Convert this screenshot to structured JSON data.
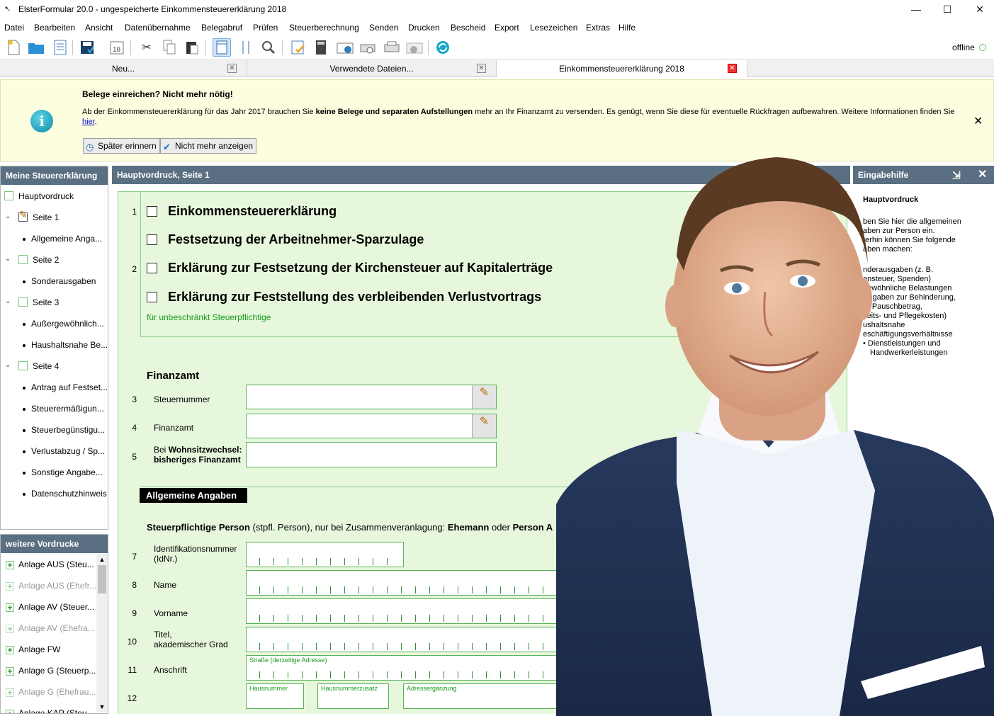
{
  "window": {
    "title": "ElsterFormular 20.0 - ungespeicherte Einkommensteuererklärung 2018",
    "minimize": "—",
    "maximize": "☐",
    "close": "✕"
  },
  "menu": [
    "Datei",
    "Bearbeiten",
    "Ansicht",
    "Datenübernahme",
    "Belegabruf",
    "Prüfen",
    "Steuerberechnung",
    "Senden",
    "Drucken",
    "Bescheid",
    "Export",
    "Lesezeichen",
    "Extras",
    "Hilfe"
  ],
  "toolbar": {
    "status": "offline",
    "calendar_day": "18",
    "icons": [
      "new-file-icon",
      "open-folder-icon",
      "list-icon",
      "save-icon",
      "calendar-icon",
      "cut-icon",
      "copy-icon",
      "paste-icon",
      "page-view-icon",
      "page-width-icon",
      "search-icon",
      "check-form-icon",
      "calculator-icon",
      "send-icon",
      "print-preview-icon",
      "print-icon",
      "download-icon",
      "refresh-icon"
    ]
  },
  "tabs": [
    {
      "label": "Neu..."
    },
    {
      "label": "Verwendete Dateien..."
    },
    {
      "label": "Einkommensteuererklärung 2018"
    }
  ],
  "banner": {
    "heading": "Belege einreichen? Nicht mehr nötig!",
    "text_1": "Ab der Einkommensteuererklärung für das Jahr 2017 brauchen Sie ",
    "text_bold": "keine Belege und separaten Aufstellungen",
    "text_2": " mehr an Ihr Finanzamt zu versenden. Es genügt, wenn Sie diese für eventuelle Rückfragen aufbewahren. Weitere Informationen finden Sie ",
    "link": "hier",
    "text_3": ".",
    "remind_later": "Später erinnern",
    "dont_show": "Nicht mehr anzeigen"
  },
  "left_panel": {
    "title": "Meine Steuererklärung",
    "items": [
      "Hauptvordruck",
      "Seite 1",
      "Allgemeine Anga...",
      "Seite 2",
      "Sonderausgaben",
      "Seite 3",
      "Außergewöhnlich...",
      "Haushaltsnahe Be...",
      "Seite 4",
      "Antrag auf Festset...",
      "Steuerermäßigun...",
      "Steuerbegünstigu...",
      "Verlustabzug / Sp...",
      "Sonstige Angabe...",
      "Datenschutzhinweis"
    ]
  },
  "more_panel": {
    "title": "weitere Vordrucke",
    "items": [
      "Anlage AUS (Steu...",
      "Anlage AUS (Ehefr...",
      "Anlage AV (Steuer...",
      "Anlage AV (Ehefra...",
      "Anlage FW",
      "Anlage G (Steuerp...",
      "Anlage G (Ehefrau...",
      "Anlage KAP (Steu..."
    ]
  },
  "main": {
    "title": "Hauptvordruck, Seite 1",
    "options": [
      "Einkommensteuererklärung",
      "Festsetzung der Arbeitnehmer-Sparzulage",
      "Erklärung zur Festsetzung der Kirchensteuer auf Kapitalerträge",
      "Erklärung zur Feststellung des verbleibenden Verlustvortrags"
    ],
    "unlimited_note": "für unbeschränkt Steuerpflichtige",
    "rows": {
      "r1": "1",
      "r2": "2",
      "r3": "3",
      "r4": "4",
      "r5": "5",
      "r7": "7",
      "r8": "8",
      "r9": "9",
      "r10": "10",
      "r11": "11",
      "r12": "12"
    },
    "finanzamt_heading": "Finanzamt",
    "steuernummer": "Steuernummer",
    "finanzamt": "Finanzamt",
    "wohnsitz_pre": "Bei ",
    "wohnsitz_bold": "Wohnsitzwechsel:",
    "wohnsitz_line2": "bisheriges Finanzamt",
    "section": "Allgemeine Angaben",
    "person_bold": "Steuerpflichtige Person",
    "person_mid": " (stpfl. Person), nur bei Zusammenveranlagung: ",
    "person_bold2": "Ehemann",
    "person_mid2": " oder ",
    "person_bold3": "Person A",
    "idnr_1": "Identifikationsnummer",
    "idnr_2": "(IdNr.)",
    "name": "Name",
    "vorname": "Vorname",
    "titel_1": "Titel,",
    "titel_2": "akademischer Grad",
    "anschrift": "Anschrift",
    "strasse": "Straße (derzeitige Adresse)",
    "hausnummer": "Hausnummer",
    "hausnummerzusatz": "Hausnummerzusatz",
    "adressergaenzung": "Adressergänzung"
  },
  "right_panel": {
    "title": "Eingabehilfe",
    "heading": "Hauptvordruck",
    "lines": [
      "ben Sie hier die allgemeinen",
      "aben zur Person ein.",
      "terhin können Sie folgende",
      "aben machen:"
    ],
    "bullets": [
      "nderausgaben (z. B.",
      "ensteuer, Spenden)",
      "gewöhnliche Belastungen",
      "Angaben zur Behinderung,",
      "e- Pauschbetrag,",
      "keits- und Pflegekosten)",
      "ushaltsnahe",
      "eschäftigungsverhältnisse",
      "Dienstleistungen und",
      "Handwerkerleistungen"
    ]
  },
  "colors": {
    "panel_header": "#5a6f81",
    "form_bg": "#e6f7dc",
    "form_border": "#8bd08b",
    "banner_bg": "#fdfde0",
    "green_text": "#1a9a1a"
  }
}
